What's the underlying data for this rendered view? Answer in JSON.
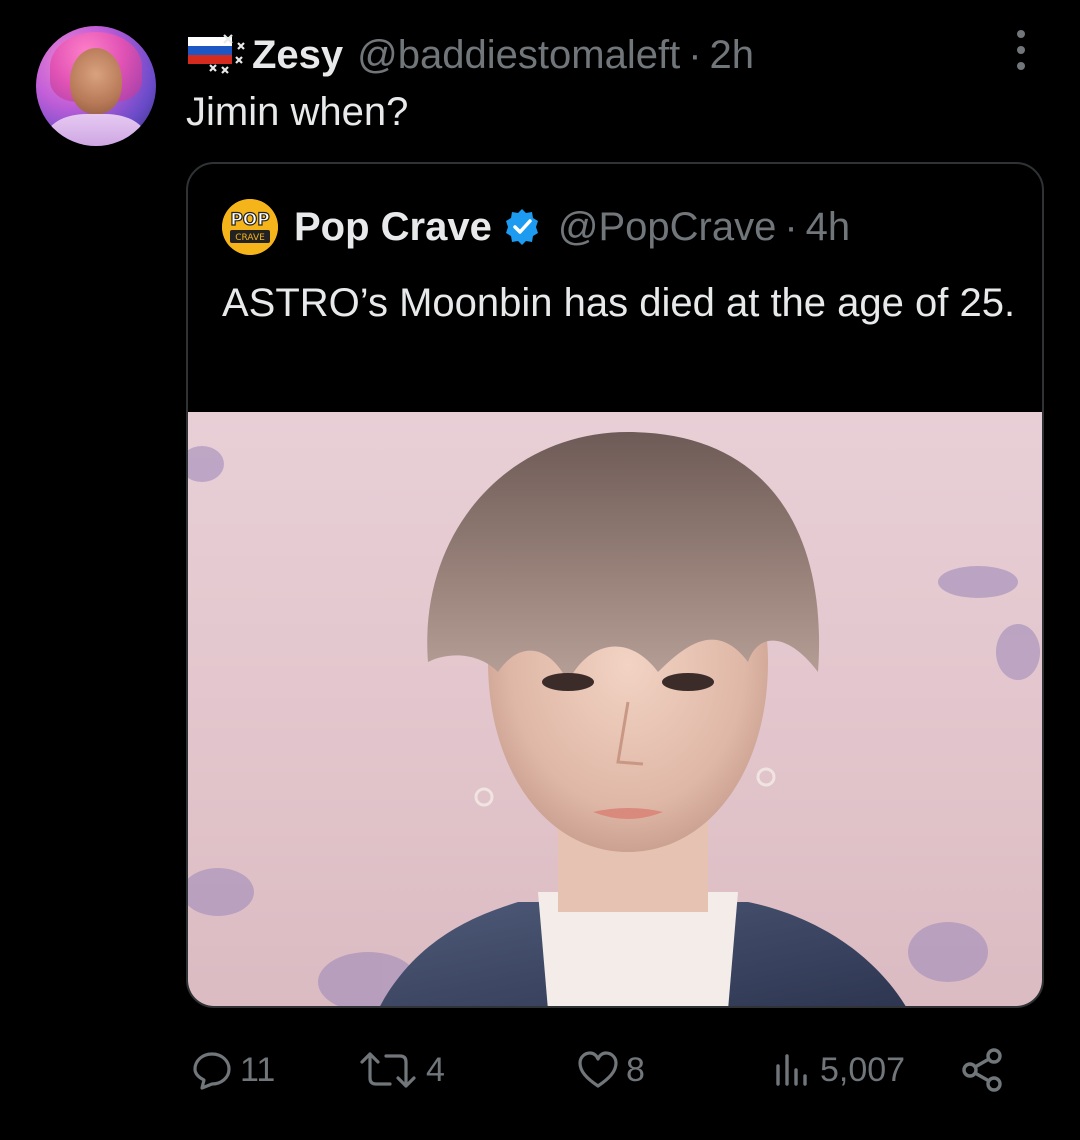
{
  "tweet": {
    "author": {
      "display_name": "Zesy",
      "handle": "@baddiestomaleft",
      "time": "2h",
      "name_prefix_icon": "russian-flag-with-x-marks-icon"
    },
    "text": "Jimin when?",
    "more_icon": "more-vertical-icon"
  },
  "quoted": {
    "author": {
      "display_name": "Pop Crave",
      "handle": "@PopCrave",
      "time": "4h",
      "avatar_text_top": "POP",
      "avatar_text_bottom": "CRAVE",
      "verified_icon": "verified-badge-icon"
    },
    "text": "ASTRO’s Moonbin has died at the age of 25.",
    "image_desc_icon": "portrait-photo"
  },
  "actions": {
    "reply_count": "11",
    "retweet_count": "4",
    "like_count": "8",
    "view_count": "5,007"
  },
  "colors": {
    "background": "#000000",
    "text_primary": "#e7e9ea",
    "text_secondary": "#71767b",
    "border": "#2f3336",
    "verified": "#1d9bf0",
    "popcrave_yellow": "#f4b41a"
  }
}
